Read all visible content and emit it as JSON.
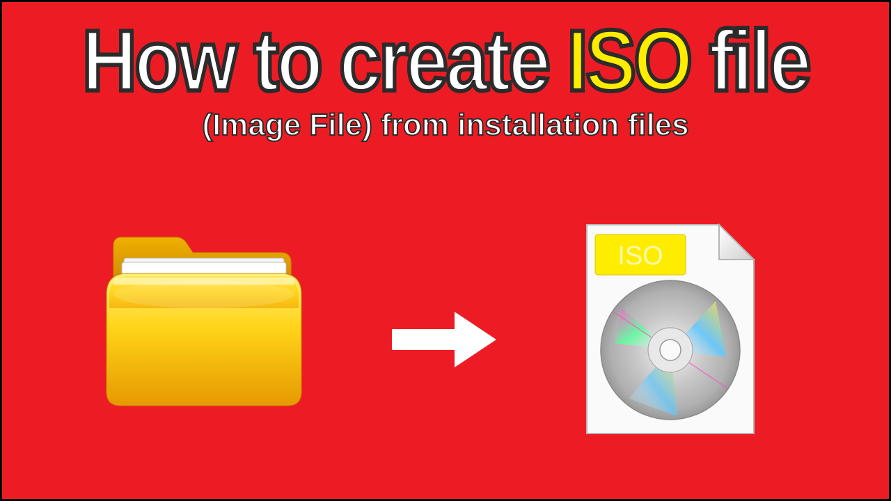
{
  "title": {
    "part1": "How to create ",
    "highlight": "ISO",
    "part2": " file"
  },
  "subtitle": "(Image File) from installation files",
  "iso_label": "ISO"
}
